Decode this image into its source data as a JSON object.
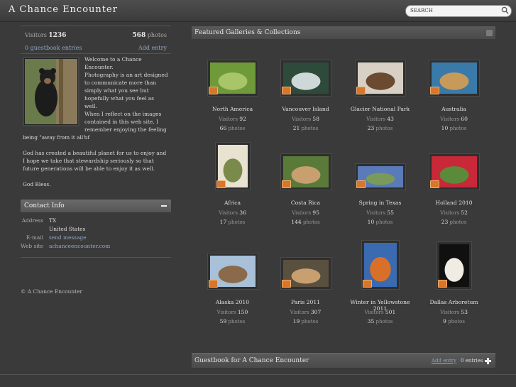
{
  "header": {
    "title": "A Chance Encounter",
    "search_placeholder": "SEARCH"
  },
  "sidebar": {
    "visitors_label": "Visitors",
    "visitors_count": "1236",
    "photos_count": "568",
    "photos_label": "photos",
    "guestbook_count": "0",
    "guestbook_label": "guestbook entries",
    "add_entry": "Add entry",
    "welcome_lines": [
      "Welcome to a Chance Encounter.",
      "Photography is an art designed to communicate more than simply what you see but hopefully what you feel as well.",
      "When I reflect on the images contained in this web site, I remember enjoying the feeling of",
      "being \"away from it all\".",
      "God has created a beautiful planet for us to enjoy and I hope we take that stewardship seriously so that future generations will be able to enjoy it as well.",
      "God Bless."
    ],
    "contact": {
      "title": "Contact Info",
      "address_label": "Address",
      "address_line1": "TX",
      "address_line2": "United States",
      "email_label": "E-mail",
      "email_value": "send message",
      "website_label": "Web site",
      "website_value": "achanceencounter.com"
    },
    "copyright": "© A Chance Encounter"
  },
  "featured": {
    "title": "Featured Galleries & Collections",
    "visitors_label": "Visitors",
    "photos_label": "photos",
    "galleries": [
      {
        "name": "North America",
        "visitors": "92",
        "photos": "66",
        "colors": [
          "#6f9a3a",
          "#a8c56a"
        ]
      },
      {
        "name": "Vancouver Island",
        "visitors": "58",
        "photos": "21",
        "colors": [
          "#2e4a3a",
          "#cfd8d8"
        ]
      },
      {
        "name": "Glacier National Park",
        "visitors": "43",
        "photos": "23",
        "colors": [
          "#d8d0c4",
          "#6a4a30"
        ]
      },
      {
        "name": "Australia",
        "visitors": "60",
        "photos": "10",
        "colors": [
          "#3a7aa8",
          "#c89a5a"
        ]
      },
      {
        "name": "Africa",
        "visitors": "36",
        "photos": "17",
        "colors": [
          "#e8e2d0",
          "#7a8a4a"
        ]
      },
      {
        "name": "Costa Rica",
        "visitors": "95",
        "photos": "144",
        "colors": [
          "#5a7a3a",
          "#c8a070"
        ]
      },
      {
        "name": "Spring in Texas",
        "visitors": "55",
        "photos": "10",
        "colors": [
          "#5a7ab8",
          "#7a9a5a"
        ]
      },
      {
        "name": "Holland 2010",
        "visitors": "52",
        "photos": "23",
        "colors": [
          "#c82838",
          "#5a8a3a"
        ]
      },
      {
        "name": "Alaska 2010",
        "visitors": "150",
        "photos": "59",
        "colors": [
          "#a8c0d8",
          "#8a6a4a"
        ]
      },
      {
        "name": "Paris 2011",
        "visitors": "307",
        "photos": "19",
        "colors": [
          "#5a5040",
          "#c8a070"
        ]
      },
      {
        "name": "Winter in Yellowstone 2011",
        "visitors": "501",
        "photos": "35",
        "colors": [
          "#3a6ab0",
          "#d8702a"
        ]
      },
      {
        "name": "Dallas Arboretum",
        "visitors": "53",
        "photos": "9",
        "colors": [
          "#101010",
          "#f0ece4"
        ]
      }
    ]
  },
  "guestbook_bar": {
    "title": "Guestbook for A Chance Encounter",
    "add_entry": "Add entry",
    "count": "0",
    "entries_label": "entries"
  }
}
